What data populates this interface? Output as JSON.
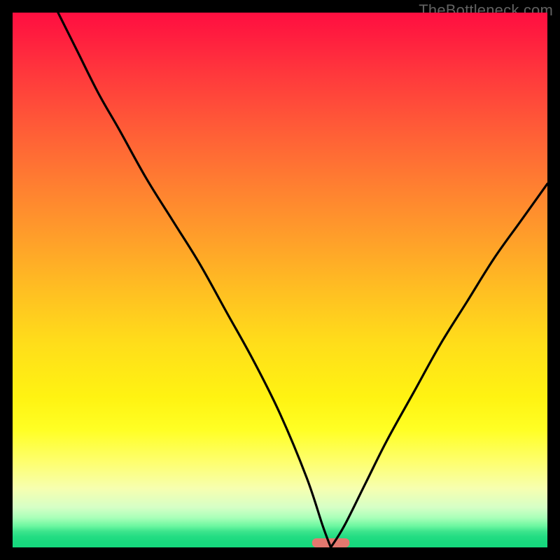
{
  "attribution": "TheBottleneck.com",
  "colors": {
    "frame": "#000000",
    "curve": "#000000",
    "marker": "#e3786f",
    "gradient_top": "#ff0e40",
    "gradient_bottom": "#15d87d"
  },
  "chart_data": {
    "type": "line",
    "title": "",
    "xlabel": "",
    "ylabel": "",
    "xlim": [
      0,
      100
    ],
    "ylim": [
      0,
      100
    ],
    "annotations": [],
    "marker": {
      "x_start": 56,
      "x_end": 63,
      "y": 0
    },
    "series": [
      {
        "name": "left-branch",
        "x": [
          8.5,
          12,
          16,
          20,
          25,
          30,
          35,
          40,
          45,
          50,
          55,
          58,
          59.5
        ],
        "values": [
          100,
          93,
          85,
          78,
          69,
          61,
          53,
          44,
          35,
          25,
          13,
          4,
          0
        ]
      },
      {
        "name": "right-branch",
        "x": [
          59.5,
          62,
          66,
          70,
          75,
          80,
          85,
          90,
          95,
          100
        ],
        "values": [
          0,
          4,
          12,
          20,
          29,
          38,
          46,
          54,
          61,
          68
        ]
      }
    ]
  }
}
